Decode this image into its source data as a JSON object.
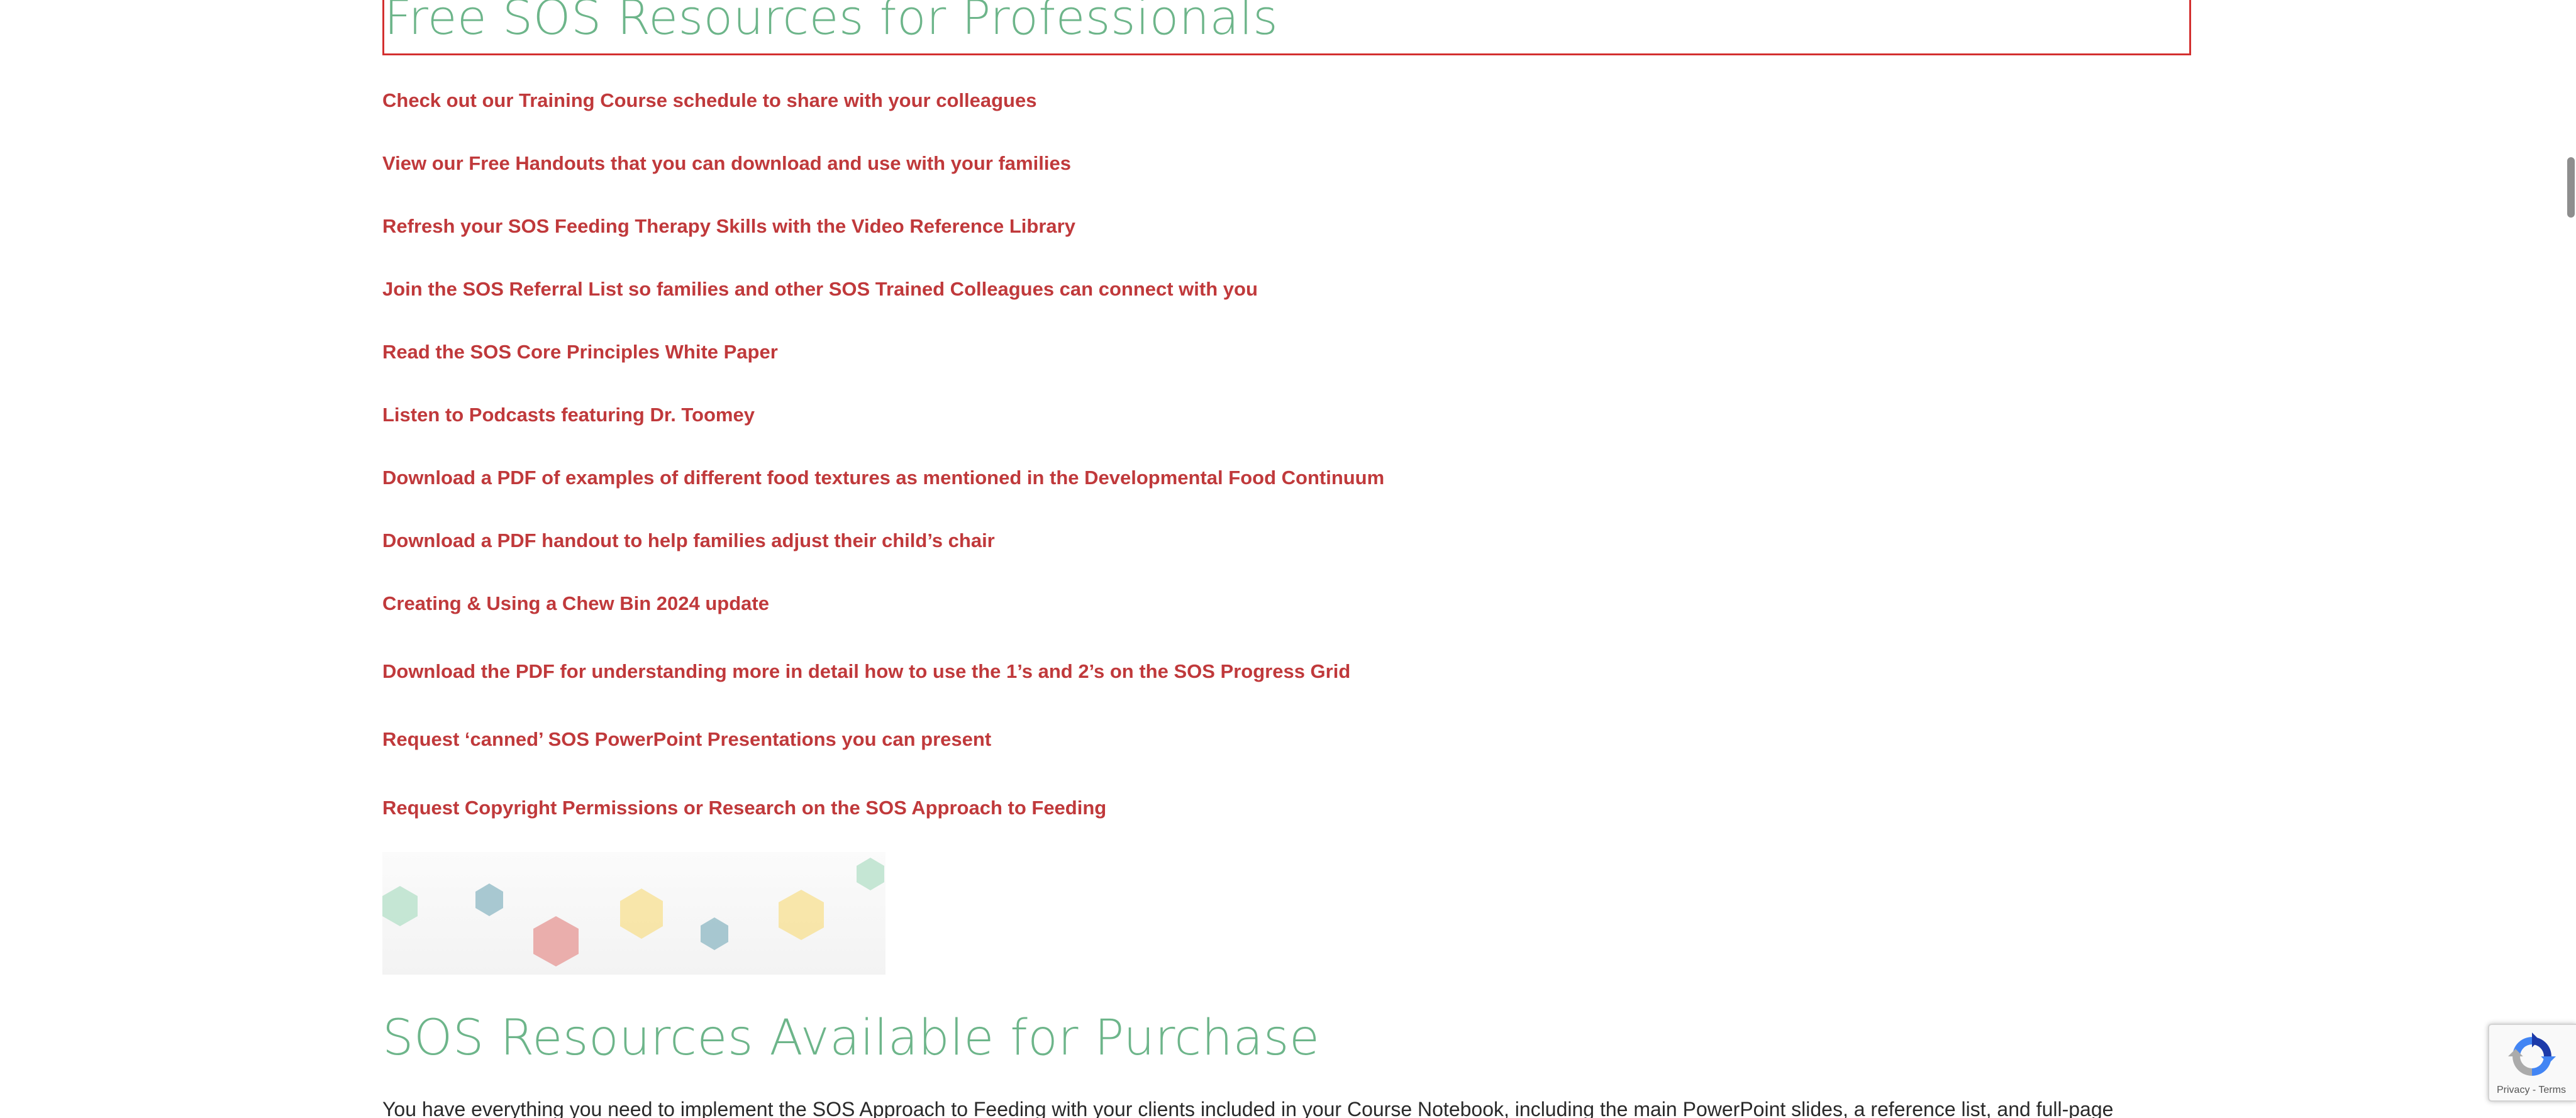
{
  "sections": {
    "free_title": "Free SOS Resources for Professionals",
    "purchase_title": "SOS Resources Available for Purchase",
    "purchase_intro": "You have everything you need to implement the SOS Approach to Feeding with your clients included in your Course Notebook, including the main PowerPoint slides, a reference list, and full-page"
  },
  "links": [
    "Check out our Training Course schedule to share with your colleagues",
    "View our Free Handouts that you can download and use with your families",
    "Refresh your SOS Feeding Therapy Skills with the Video Reference Library",
    "Join the SOS Referral List so families and other SOS Trained Colleagues can connect with you",
    "Read the SOS Core Principles White Paper",
    "Listen to Podcasts featuring Dr. Toomey",
    "Download a PDF of examples of different food textures as mentioned in the Developmental Food Continuum",
    "Download a PDF handout to help families adjust their child’s chair",
    "Creating & Using a Chew Bin 2024 update",
    "Download the PDF for understanding more in detail how to use the 1’s and 2’s on the SOS Progress Grid",
    "Request ‘canned’ SOS PowerPoint Presentations you can present",
    "Request Copyright Permissions or Research on the SOS Approach to Feeding"
  ],
  "recaptcha": {
    "terms": "Privacy - Terms"
  },
  "colors": {
    "heading_green": "#6db58a",
    "link_red": "#c0393b",
    "focus_outline": "#d32f2f",
    "hex_green": "#bfe3cf",
    "hex_blue": "#9fc2cc",
    "hex_red": "#e9a6a4",
    "hex_yellow": "#f7e3a1"
  }
}
